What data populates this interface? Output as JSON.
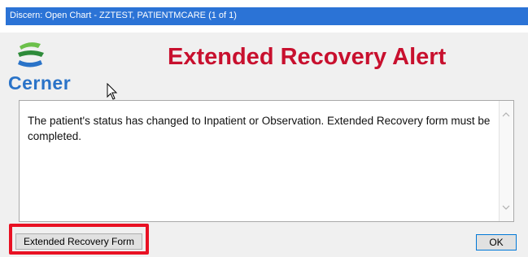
{
  "window": {
    "title": "Discern: Open Chart - ZZTEST, PATIENTMCARE (1 of 1)"
  },
  "logo": {
    "text": "Cerner",
    "icon": "cerner-logo-icon"
  },
  "alert": {
    "title": "Extended Recovery Alert",
    "message": "The patient's status has changed to Inpatient or Observation. Extended Recovery form must be completed."
  },
  "buttons": {
    "form_label": "Extended Recovery Form",
    "ok_label": "OK"
  },
  "colors": {
    "title_bar": "#2b73d6",
    "alert_title": "#c8102e",
    "brand": "#2a73c8",
    "highlight": "#e81123"
  }
}
